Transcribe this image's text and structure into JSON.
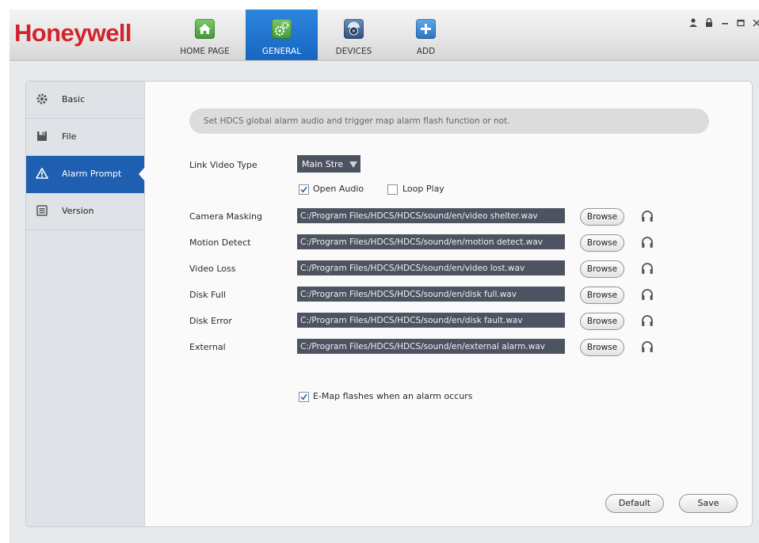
{
  "app": {
    "logo": "Honeywell",
    "nav": [
      {
        "label": "HOME PAGE",
        "icon": "home-icon"
      },
      {
        "label": "GENERAL",
        "icon": "gears-icon"
      },
      {
        "label": "DEVICES",
        "icon": "camera-icon"
      },
      {
        "label": "ADD",
        "icon": "plus-icon"
      }
    ],
    "window_controls": [
      "user-icon",
      "lock-icon",
      "minimize-icon",
      "maximize-icon",
      "close-icon"
    ],
    "active_nav_color": "#1f6fd0"
  },
  "sidebar": {
    "items": [
      {
        "label": "Basic",
        "icon": "gear-icon"
      },
      {
        "label": "File",
        "icon": "floppy-icon"
      },
      {
        "label": "Alarm Prompt",
        "icon": "warning-icon"
      },
      {
        "label": "Version",
        "icon": "list-icon"
      }
    ],
    "active_color": "#1f5fb1"
  },
  "content": {
    "info": "Set HDCS global alarm audio and trigger map alarm flash function or not.",
    "link_video_type_label": "Link Video Type",
    "link_video_type_value": "Main Stre",
    "open_audio_label": "Open Audio",
    "open_audio_checked": true,
    "loop_play_label": "Loop Play",
    "loop_play_checked": false,
    "browse_label": "Browse",
    "alarms": [
      {
        "label": "Camera Masking",
        "path": "C:/Program Files/HDCS/HDCS/sound/en/video shelter.wav"
      },
      {
        "label": "Motion Detect",
        "path": "C:/Program Files/HDCS/HDCS/sound/en/motion detect.wav"
      },
      {
        "label": "Video Loss",
        "path": "C:/Program Files/HDCS/HDCS/sound/en/video lost.wav"
      },
      {
        "label": "Disk Full",
        "path": "C:/Program Files/HDCS/HDCS/sound/en/disk full.wav"
      },
      {
        "label": "Disk Error",
        "path": "C:/Program Files/HDCS/HDCS/sound/en/disk fault.wav"
      },
      {
        "label": "External",
        "path": "C:/Program Files/HDCS/HDCS/sound/en/external alarm.wav"
      }
    ],
    "emap_label": "E-Map flashes when an alarm occurs",
    "emap_checked": true,
    "default_label": "Default",
    "save_label": "Save"
  }
}
